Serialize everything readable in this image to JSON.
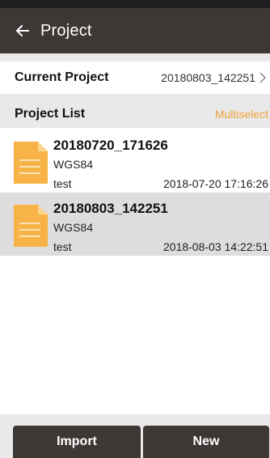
{
  "app_bar": {
    "title": "Project",
    "back_icon": "arrow-left-icon",
    "background": "#3d3836"
  },
  "current_project": {
    "label": "Current Project",
    "value": "20180803_142251",
    "chevron_icon": "chevron-right-icon"
  },
  "project_list": {
    "label": "Project List",
    "multiselect_label": "Multiselect",
    "accent": "#f0a33a",
    "items": [
      {
        "name": "20180720_171626",
        "crs": "WGS84",
        "description": "test",
        "date": "2018-07-20 17:16:26",
        "icon": "document-icon",
        "selected": false
      },
      {
        "name": "20180803_142251",
        "crs": "WGS84",
        "description": "test",
        "date": "2018-08-03 14:22:51",
        "icon": "document-icon",
        "selected": true
      }
    ]
  },
  "buttons": {
    "import_label": "Import",
    "new_label": "New"
  }
}
